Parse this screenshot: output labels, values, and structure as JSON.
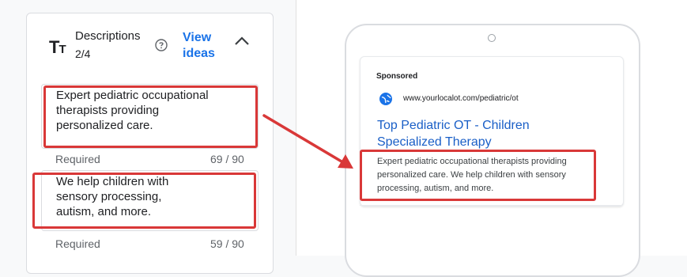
{
  "descriptions_panel": {
    "icon_big": "T",
    "icon_small": "T",
    "title": "Descriptions",
    "count": "2/4",
    "view_ideas": "View ideas",
    "fields": [
      {
        "value": "Expert pediatric occupational therapists providing personalized care.",
        "hint": "Required",
        "char_count": "69 / 90"
      },
      {
        "value": "We help children with sensory processing, autism, and more.",
        "hint": "Required",
        "char_count": "59 / 90"
      }
    ]
  },
  "ad_preview": {
    "sponsored": "Sponsored",
    "url": "www.yourlocalot.com/pediatric/ot",
    "title": "Top Pediatric OT - Children Specialized Therapy",
    "description": "Expert pediatric occupational therapists providing personalized care. We help children with sensory processing, autism, and more."
  },
  "annotation_color": "#d93838",
  "link_color": "#1a73e8"
}
